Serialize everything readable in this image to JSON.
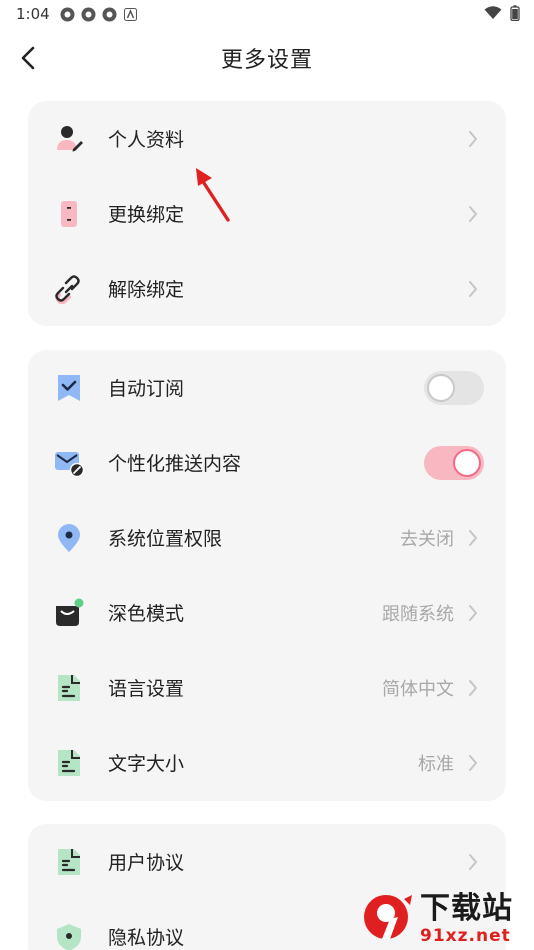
{
  "status_bar": {
    "time": "1:04"
  },
  "header": {
    "title": "更多设置"
  },
  "group1": [
    {
      "label": "个人资料"
    },
    {
      "label": "更换绑定"
    },
    {
      "label": "解除绑定"
    }
  ],
  "group2": [
    {
      "label": "自动订阅",
      "toggle": "off"
    },
    {
      "label": "个性化推送内容",
      "toggle": "on"
    },
    {
      "label": "系统位置权限",
      "value": "去关闭"
    },
    {
      "label": "深色模式",
      "value": "跟随系统"
    },
    {
      "label": "语言设置",
      "value": "简体中文"
    },
    {
      "label": "文字大小",
      "value": "标准"
    }
  ],
  "group3": [
    {
      "label": "用户协议"
    },
    {
      "label": "隐私协议"
    }
  ],
  "watermark": {
    "title": "下载站",
    "domain": "91xz.net"
  },
  "colors": {
    "accent_pink": "#f26a86",
    "icon_pink": "#f8b8c2",
    "icon_blue": "#8fb8f5",
    "icon_green": "#b5e5c5",
    "annotation_arrow": "#e02020"
  }
}
